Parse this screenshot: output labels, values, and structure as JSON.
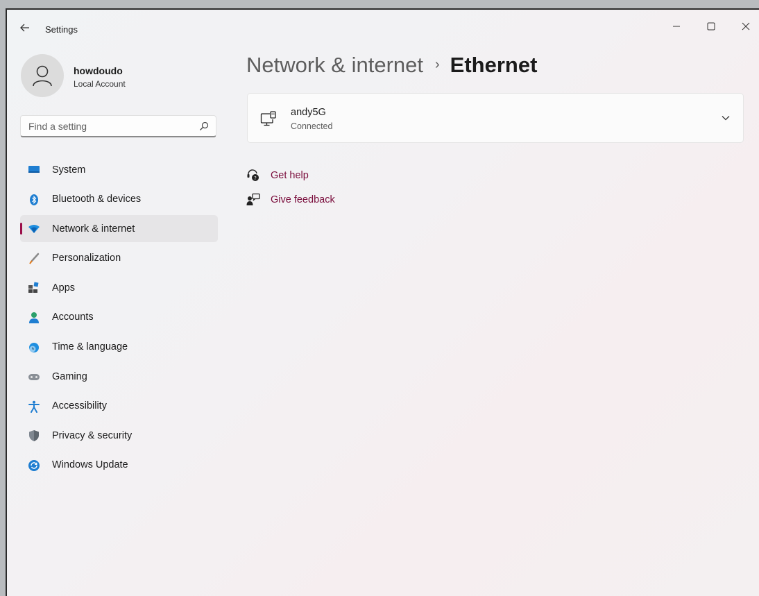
{
  "titlebar": {
    "title": "Settings",
    "back_icon": "arrow-left-icon",
    "minimize_icon": "minimize-icon",
    "maximize_icon": "maximize-icon",
    "close_icon": "close-icon"
  },
  "profile": {
    "name": "howdoudo",
    "account_type": "Local Account",
    "avatar_icon": "person-icon"
  },
  "search": {
    "placeholder": "Find a setting",
    "value": "",
    "icon": "search-icon"
  },
  "nav": {
    "items": [
      {
        "label": "System",
        "icon": "monitor-icon",
        "selected": false
      },
      {
        "label": "Bluetooth & devices",
        "icon": "bluetooth-icon",
        "selected": false
      },
      {
        "label": "Network & internet",
        "icon": "wifi-icon",
        "selected": true
      },
      {
        "label": "Personalization",
        "icon": "brush-icon",
        "selected": false
      },
      {
        "label": "Apps",
        "icon": "apps-icon",
        "selected": false
      },
      {
        "label": "Accounts",
        "icon": "person-icon",
        "selected": false
      },
      {
        "label": "Time & language",
        "icon": "globe-clock-icon",
        "selected": false
      },
      {
        "label": "Gaming",
        "icon": "gamepad-icon",
        "selected": false
      },
      {
        "label": "Accessibility",
        "icon": "accessibility-icon",
        "selected": false
      },
      {
        "label": "Privacy & security",
        "icon": "shield-icon",
        "selected": false
      },
      {
        "label": "Windows Update",
        "icon": "update-icon",
        "selected": false
      }
    ],
    "selected_indicator_color": "#9b0f4a"
  },
  "main": {
    "breadcrumb": {
      "parent": "Network & internet",
      "separator": "›",
      "current": "Ethernet"
    },
    "connection": {
      "name": "andy5G",
      "status": "Connected",
      "icon": "ethernet-monitor-icon",
      "expand_icon": "chevron-down-icon"
    },
    "links": [
      {
        "label": "Get help",
        "icon": "help-icon"
      },
      {
        "label": "Give feedback",
        "icon": "feedback-icon"
      }
    ],
    "link_color": "#7a0d3c"
  }
}
